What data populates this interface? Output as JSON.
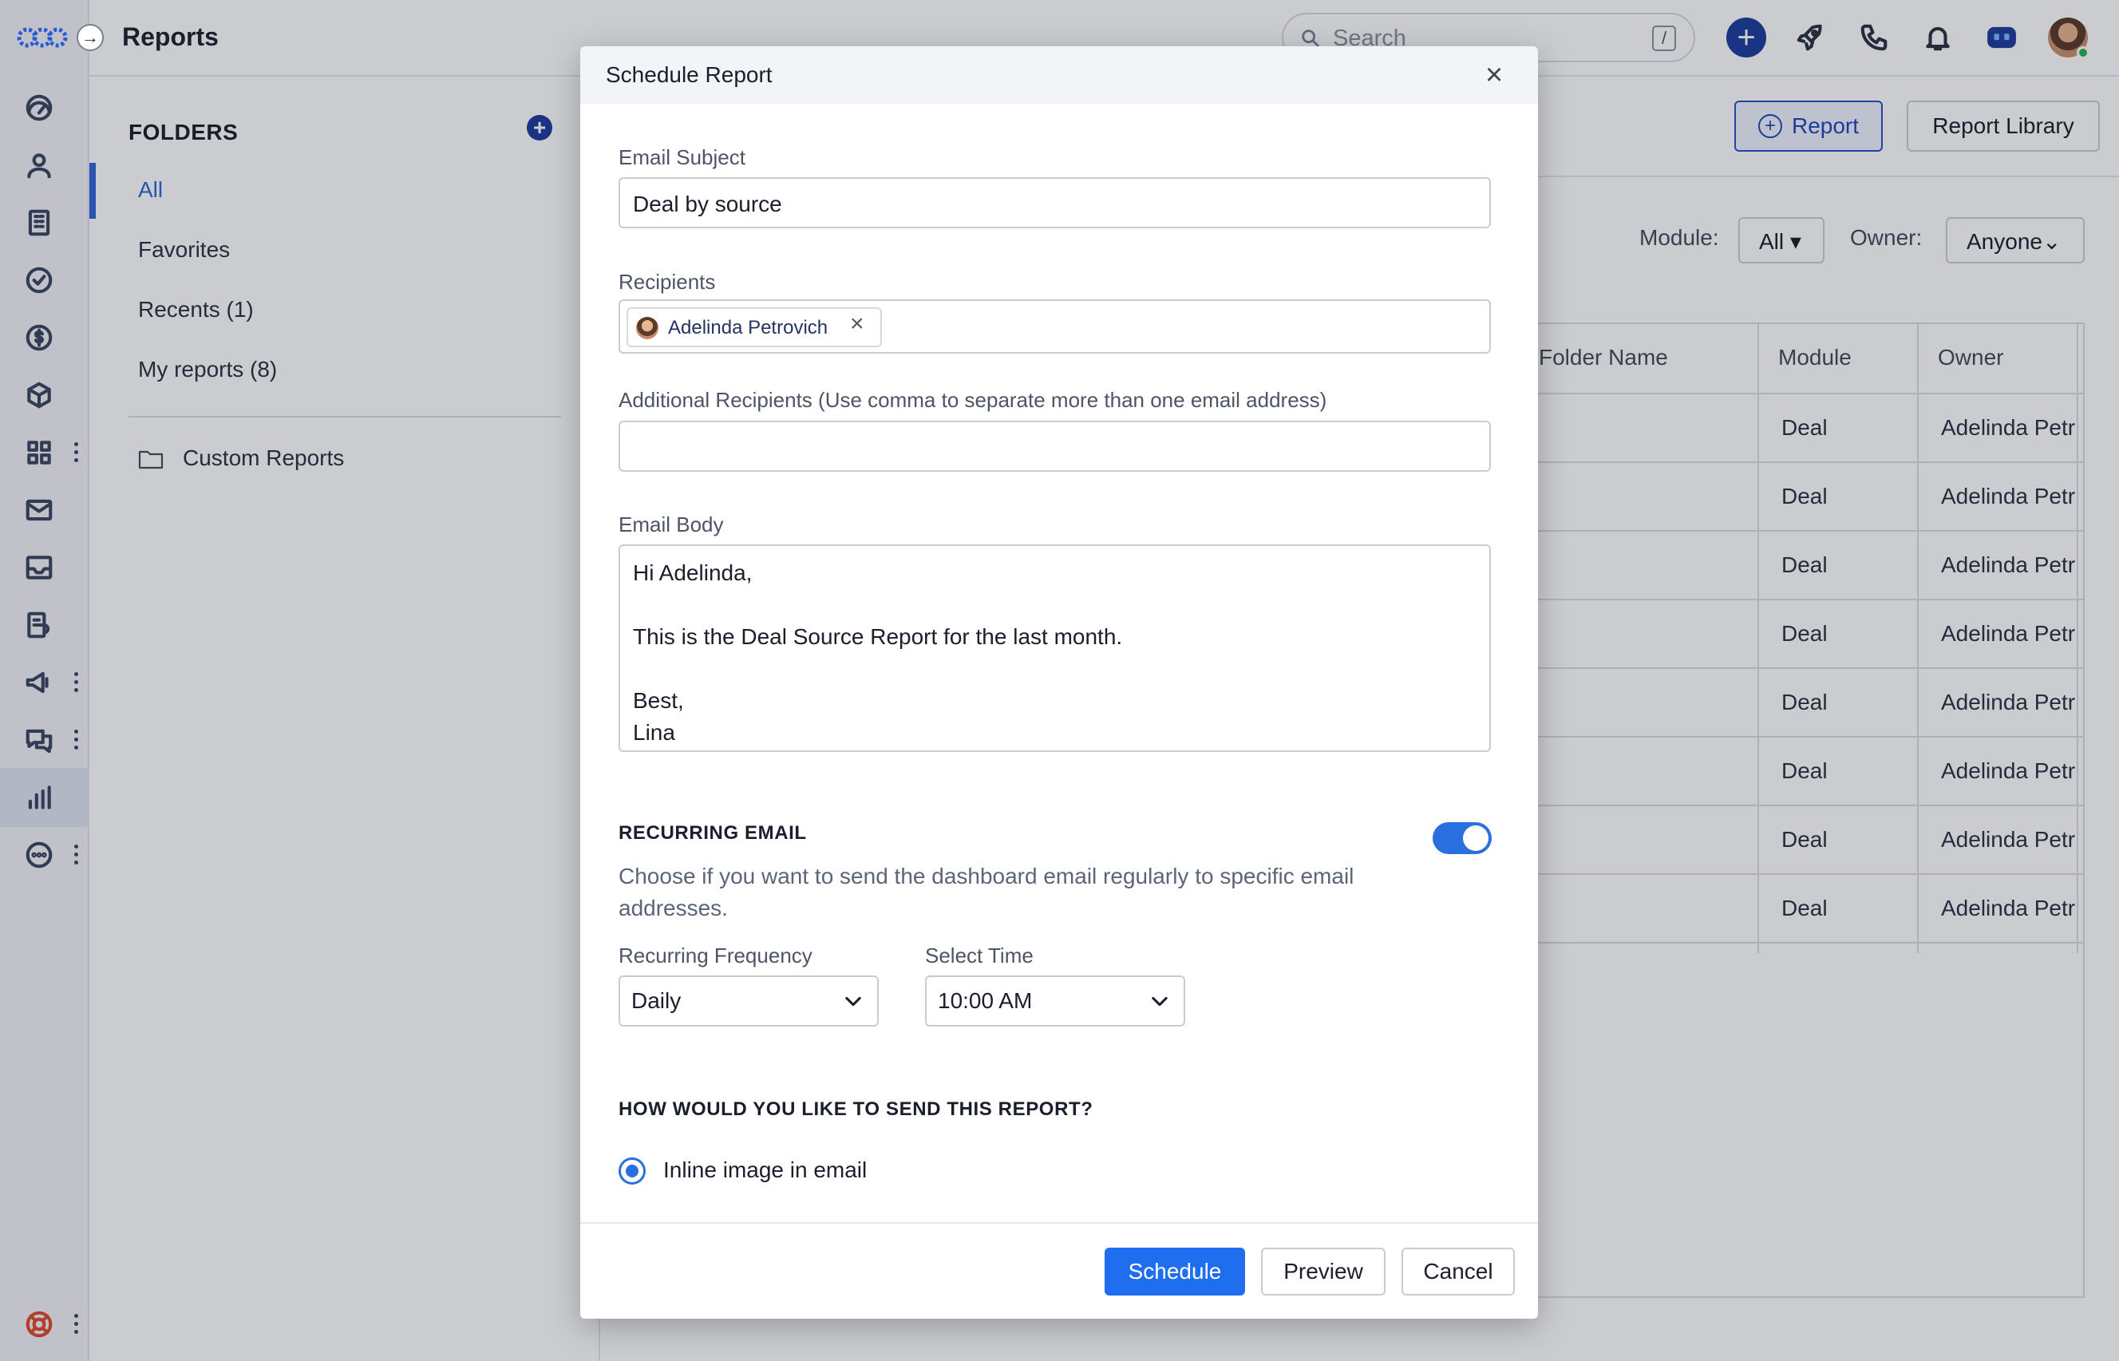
{
  "topbar": {
    "title": "Reports",
    "search_placeholder": "Search",
    "search_shortcut": "/"
  },
  "rail": {
    "icons": [
      "dashboard-icon",
      "contacts-icon",
      "companies-icon",
      "tasks-icon",
      "deals-icon",
      "products-icon",
      "apps-icon",
      "email-icon",
      "inbox-icon",
      "workflow-icon",
      "campaigns-icon",
      "chat-icon",
      "reports-icon",
      "more-icon",
      "help-icon"
    ]
  },
  "folders": {
    "title": "FOLDERS",
    "items": [
      {
        "label": "All"
      },
      {
        "label": "Favorites"
      },
      {
        "label": "Recents (1)"
      },
      {
        "label": "My reports (8)"
      }
    ],
    "custom": "Custom Reports"
  },
  "main": {
    "report_button": "Report",
    "library_button": "Report Library",
    "module_label": "Module:",
    "module_value": "All",
    "owner_label": "Owner:",
    "owner_value": "Anyone",
    "columns": [
      "Folder Name",
      "Module",
      "Owner"
    ],
    "rows": [
      {
        "module": "Deal",
        "owner": "Adelinda Petr"
      },
      {
        "module": "Deal",
        "owner": "Adelinda Petr"
      },
      {
        "module": "Deal",
        "owner": "Adelinda Petr"
      },
      {
        "module": "Deal",
        "owner": "Adelinda Petr"
      },
      {
        "module": "Deal",
        "owner": "Adelinda Petr"
      },
      {
        "module": "Deal",
        "owner": "Adelinda Petr"
      },
      {
        "module": "Deal",
        "owner": "Adelinda Petr"
      },
      {
        "module": "Deal",
        "owner": "Adelinda Petr"
      }
    ]
  },
  "modal": {
    "title": "Schedule Report",
    "close": "×",
    "subject_label": "Email Subject",
    "subject_value": "Deal by source",
    "recipients_label": "Recipients",
    "recipient_name": "Adelinda Petrovich",
    "additional_label": "Additional Recipients (Use comma to separate more than one email address)",
    "additional_value": "",
    "body_label": "Email Body",
    "body_value": "Hi Adelinda,\n\nThis is the Deal Source Report for the last month.\n\nBest,\nLina",
    "recurring_title": "RECURRING EMAIL",
    "recurring_enabled": true,
    "recurring_desc": "Choose if you want to send the dashboard email regularly to specific email addresses.",
    "frequency_label": "Recurring Frequency",
    "frequency_value": "Daily",
    "time_label": "Select Time",
    "time_value": "10:00 AM",
    "send_title": "HOW WOULD YOU LIKE TO SEND THIS REPORT?",
    "send_option": "Inline image in email",
    "schedule_button": "Schedule",
    "preview_button": "Preview",
    "cancel_button": "Cancel"
  },
  "colors": {
    "accent": "#1f6ef0",
    "brand": "#1d3c9c",
    "overlay": "#101828"
  }
}
